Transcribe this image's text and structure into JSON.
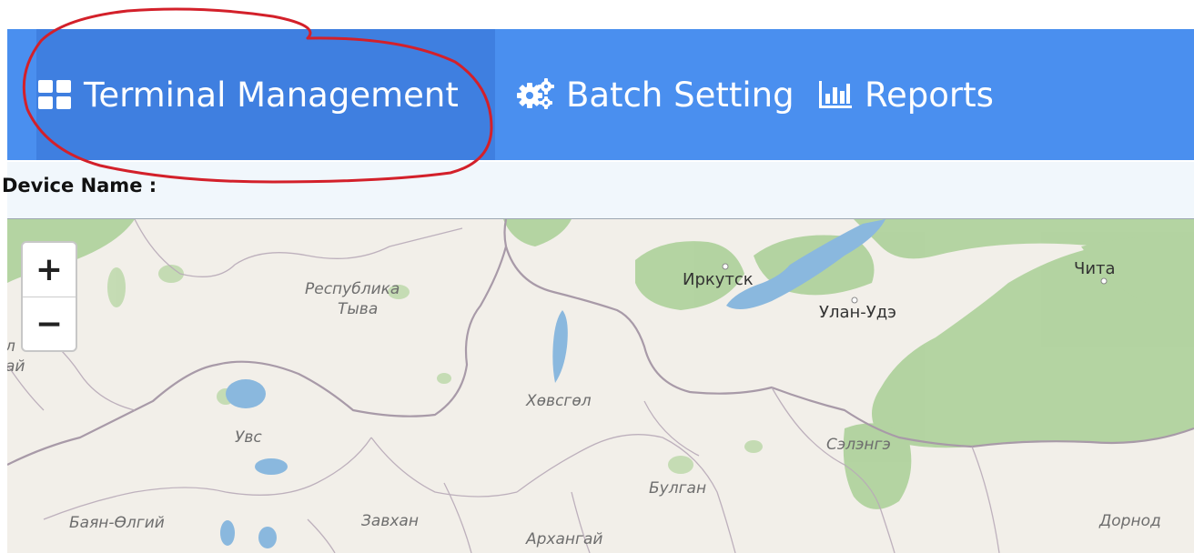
{
  "nav": {
    "items": [
      {
        "label": "Terminal Management",
        "icon": "grid-icon",
        "active": true
      },
      {
        "label": "Batch Setting",
        "icon": "gears-icon",
        "active": false
      },
      {
        "label": "Reports",
        "icon": "bar-chart-icon",
        "active": false
      }
    ]
  },
  "info": {
    "device_name_label": "Device Name :"
  },
  "map": {
    "zoom_in": "+",
    "zoom_out": "−",
    "labels": {
      "tuva_1": "Республика",
      "tuva_2": "Тыва",
      "irkutsk": "Иркутск",
      "ulan_ude": "Улан-Удэ",
      "chita": "Чита",
      "khuvsgul": "Хөвсгөл",
      "uvs": "Увс",
      "selenge": "Сэлэнгэ",
      "bulgan": "Булган",
      "bayan_ulgii": "Баян-Өлгий",
      "zavkhan": "Завхан",
      "arkhangai": "Архангай",
      "dornod": "Дорнод",
      "edge_1": "л",
      "edge_2": "ай"
    }
  },
  "colors": {
    "nav_bg": "#4a8fef",
    "nav_active_bg": "#3f7fe0",
    "annotation": "#d3202a",
    "map_land": "#f2efe9",
    "map_forest": "#a9cf95",
    "map_water": "#8ab8de"
  }
}
